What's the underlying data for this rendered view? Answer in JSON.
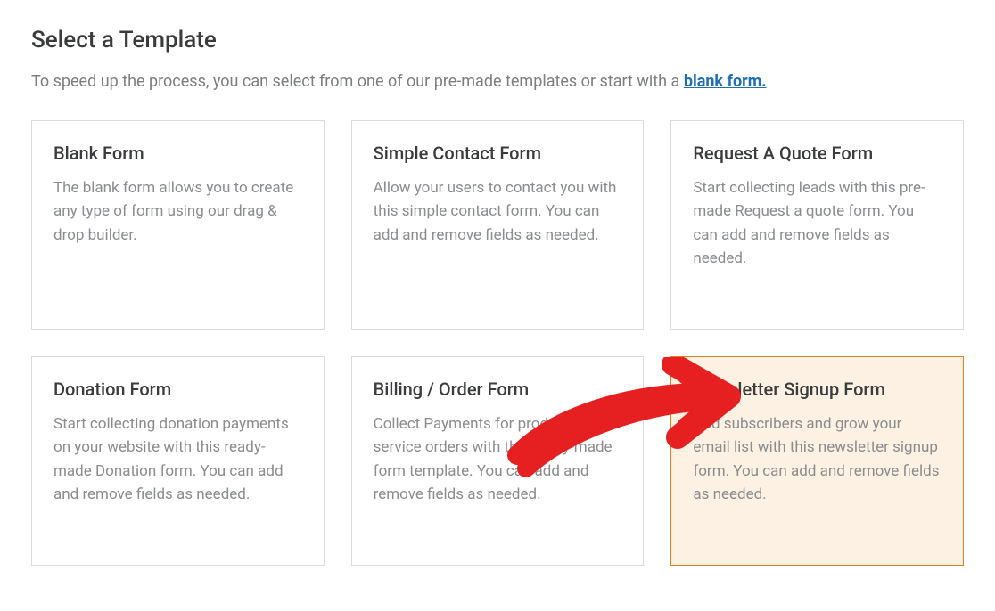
{
  "header": {
    "title": "Select a Template",
    "description_prefix": "To speed up the process, you can select from one of our pre-made templates or start with a ",
    "blank_link_text": "blank form."
  },
  "templates": [
    {
      "title": "Blank Form",
      "description": "The blank form allows you to create any type of form using our drag & drop builder."
    },
    {
      "title": "Simple Contact Form",
      "description": "Allow your users to contact you with this simple contact form. You can add and remove fields as needed."
    },
    {
      "title": "Request A Quote Form",
      "description": "Start collecting leads with this pre-made Request a quote form. You can add and remove fields as needed."
    },
    {
      "title": "Donation Form",
      "description": "Start collecting donation payments on your website with this ready-made Donation form. You can add and remove fields as needed."
    },
    {
      "title": "Billing / Order Form",
      "description": "Collect Payments for product and service orders with this ready-made form template. You can add and remove fields as needed."
    },
    {
      "title": "Newsletter Signup Form",
      "description": "Add subscribers and grow your email list with this newsletter signup form. You can add and remove fields as needed."
    }
  ],
  "highlighted_index": 5
}
